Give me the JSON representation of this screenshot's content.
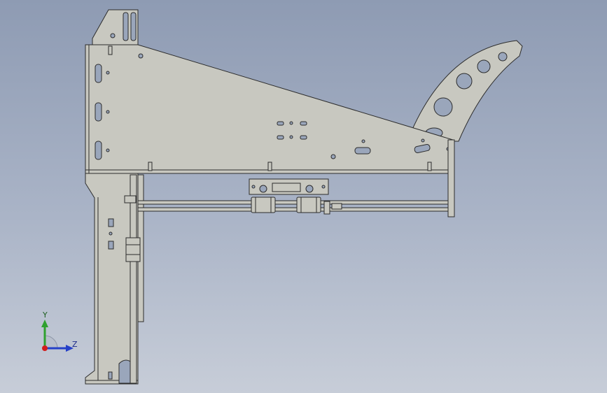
{
  "viewport": {
    "background_top": "#8e9bb3",
    "background_bottom": "#c7cdd8"
  },
  "model": {
    "part_fill": "#c8c8c0",
    "part_edge": "#2c2c2c",
    "hole_fill": "#9aa6bb"
  },
  "triad": {
    "y_label": "Y",
    "z_label": "Z",
    "y_color": "#2fa12f",
    "z_color": "#2540c8",
    "x_color": "#d21d1d"
  }
}
